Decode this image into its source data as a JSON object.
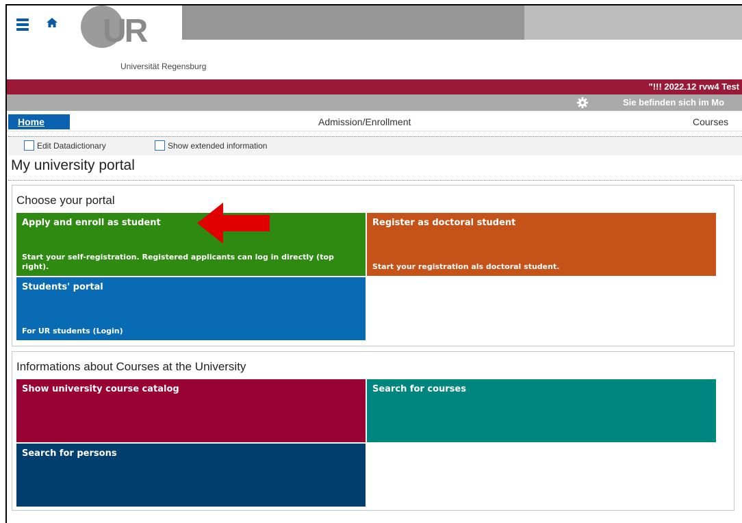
{
  "header": {
    "logo_letters": "UR",
    "logo_text": "Universität Regensburg",
    "menu_icon": "menu-icon",
    "home_icon": "home-icon"
  },
  "redbar": {
    "text": "\"!!! 2022.12 rvw4 Test"
  },
  "greybar": {
    "text": "Sie befinden sich im Mo",
    "gear_icon": "gear-icon"
  },
  "nav": {
    "home": "Home",
    "admission": "Admission/Enrollment",
    "courses": "Courses"
  },
  "devbar": {
    "edit_datadictionary": "Edit Datadictionary",
    "show_extended": "Show extended information"
  },
  "page_title": "My university portal",
  "portal_section": {
    "title": "Choose your portal",
    "tiles": [
      {
        "title": "Apply and enroll as student",
        "desc": "Start your self-registration. Registered applicants can log in directly (top right).",
        "color": "#2e8a10"
      },
      {
        "title": "Register as doctoral student",
        "desc": "Start your registration als doctoral student.",
        "color": "#c55219"
      },
      {
        "title": "Students' portal",
        "desc": "For UR students (Login)",
        "color": "#0a6bb5"
      }
    ]
  },
  "courses_section": {
    "title": "Informations about Courses at the University",
    "tiles": [
      {
        "title": "Show university course catalog",
        "color": "#990033"
      },
      {
        "title": "Search for courses",
        "color": "#00867f"
      },
      {
        "title": "Search for persons",
        "color": "#023f6e"
      }
    ]
  },
  "annotation": {
    "arrow_color": "#e00000"
  }
}
